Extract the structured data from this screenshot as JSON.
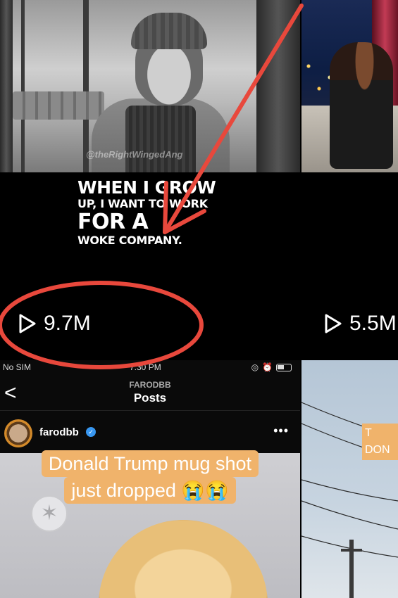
{
  "grid": {
    "tiles": [
      {
        "watermark": "@theRightWingedAng",
        "caption_lines": [
          "WHEN I GROW",
          "UP, I WANT TO WORK",
          "FOR A",
          "WOKE COMPANY."
        ],
        "views": "9.7M"
      },
      {
        "views": "5.5M"
      },
      {
        "status_bar": {
          "carrier": "No SIM",
          "time": "7:30 PM"
        },
        "nav": {
          "username": "FARODBB",
          "title": "Posts",
          "back_glyph": "<"
        },
        "post": {
          "handle": "farodbb",
          "more_glyph": "•••",
          "caption_line_1": "Donald Trump mug shot",
          "caption_line_2": "just dropped 😭😭"
        }
      },
      {
        "caption_lines": [
          "T",
          "DON"
        ]
      }
    ]
  },
  "annotation": {
    "color": "#e8483c"
  },
  "colors": {
    "background": "#000000",
    "caption_bg": "#f0b36b",
    "verified": "#3897f0"
  }
}
